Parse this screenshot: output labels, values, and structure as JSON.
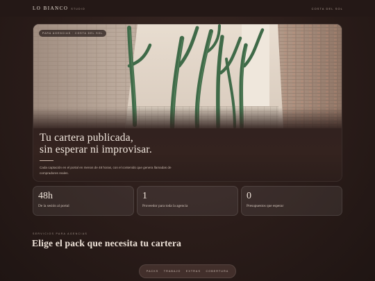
{
  "header": {
    "brand_name": "LO BIANCO",
    "brand_sub": "STUDIO",
    "top_link": "COSTA DEL SOL"
  },
  "hero": {
    "tag": "PARA AGENCIAS · COSTA DEL SOL",
    "title_line1": "Tu cartera publicada,",
    "title_line2": "sin esperar ni improvisar.",
    "body": "Cada captación en el portal en menos de 48 horas, con el contenido que genera llamadas de compradores reales."
  },
  "stats": [
    {
      "value": "48h",
      "label": "De la sesión al portal"
    },
    {
      "value": "1",
      "label": "Proveedor para toda la agencia"
    },
    {
      "value": "0",
      "label": "Presupuestos que esperar"
    }
  ],
  "services": {
    "kicker": "SERVICIOS PARA AGENCIAS",
    "title": "Elige el pack que necesita tu cartera"
  },
  "nav": {
    "items": [
      "PACKS",
      "TRABAJO",
      "EXTRAS",
      "COBERTURA"
    ]
  },
  "colors": {
    "background": "#2a1c19",
    "topbar": "#241816",
    "text": "#efe4da",
    "accent_rule": "#c9b2a4"
  }
}
